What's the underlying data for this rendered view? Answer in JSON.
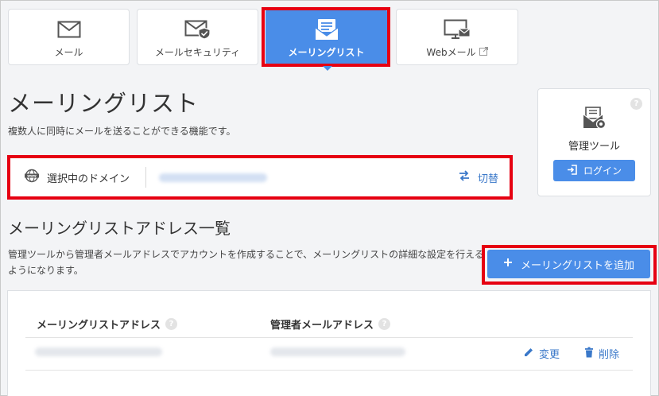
{
  "tabs": [
    {
      "label": "メール",
      "icon": "mail-icon"
    },
    {
      "label": "メールセキュリティ",
      "icon": "mail-security-icon"
    },
    {
      "label": "メーリングリスト",
      "icon": "mailing-list-icon",
      "active": true
    },
    {
      "label": "Webメール",
      "icon": "webmail-icon",
      "external_icon": "external-link-icon"
    }
  ],
  "page": {
    "title": "メーリングリスト",
    "description": "複数人に同時にメールを送ることができる機能です。"
  },
  "domain_bar": {
    "label": "選択中のドメイン",
    "icon": "globe-www-icon",
    "switch_label": "切替",
    "switch_icon": "swap-arrows-icon"
  },
  "admin_tool": {
    "help": "?",
    "title": "管理ツール",
    "login_label": "ログイン",
    "login_icon": "login-icon"
  },
  "section": {
    "title": "メーリングリストアドレス一覧",
    "description": "管理ツールから管理者メールアドレスでアカウントを作成することで、メーリングリストの詳細な設定を行えるようになります。",
    "add_button": "メーリングリストを追加",
    "add_icon": "plus-icon"
  },
  "table": {
    "columns": [
      {
        "label": "メーリングリストアドレス",
        "help": "?"
      },
      {
        "label": "管理者メールアドレス",
        "help": "?"
      }
    ],
    "row_actions": {
      "edit_label": "変更",
      "delete_label": "削除"
    }
  },
  "colors": {
    "accent": "#4a8de8",
    "highlight_frame": "#e60012",
    "link": "#3a78c9",
    "background": "#f3f4f6"
  }
}
